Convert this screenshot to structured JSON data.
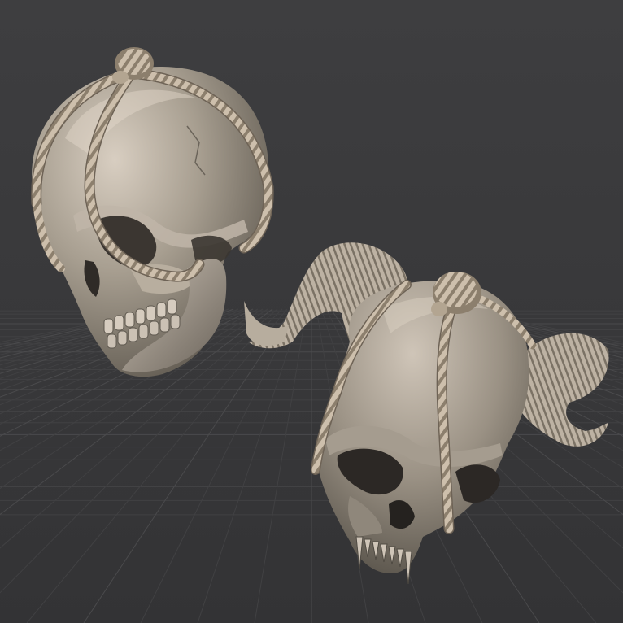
{
  "viewport": {
    "background_top": "#3d3d3f",
    "background_bottom": "#333335",
    "grid_color": "#4a4a4c",
    "grid_color_faint": "#414143"
  },
  "materials": {
    "bone_light": "#d9cfc2",
    "bone_mid": "#a9a091",
    "bone_dark": "#5d574e",
    "shadow": "#2a2724",
    "rope_light": "#e0d3c1",
    "rope_dark": "#8a7d6c"
  },
  "objects": [
    {
      "name": "human-skull-with-rope",
      "description_visible": false
    },
    {
      "name": "horned-demon-skull-with-rope",
      "description_visible": false
    }
  ]
}
